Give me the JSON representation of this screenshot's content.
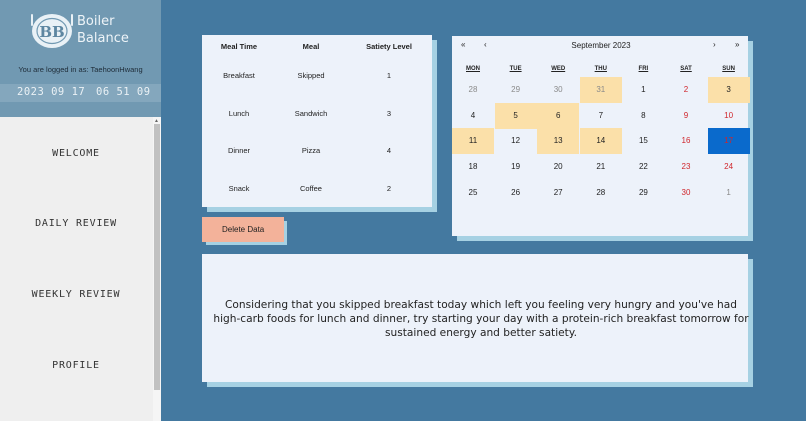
{
  "app": {
    "brand_line1": "Boiler",
    "brand_line2": "Balance",
    "logo_text": "BB"
  },
  "session": {
    "login_text": "You are logged in as: TaehoonHwang",
    "date": "2023 09 17",
    "time": "06 51 09"
  },
  "nav": [
    {
      "label": "WELCOME"
    },
    {
      "label": "DAILY REVIEW"
    },
    {
      "label": "WEEKLY REVIEW"
    },
    {
      "label": "PROFILE"
    }
  ],
  "meal_table": {
    "headers": [
      "Meal Time",
      "Meal",
      "Satiety Level"
    ],
    "rows": [
      [
        "Breakfast",
        "Skipped",
        "1"
      ],
      [
        "Lunch",
        "Sandwich",
        "3"
      ],
      [
        "Dinner",
        "Pizza",
        "4"
      ],
      [
        "Snack",
        "Coffee",
        "2"
      ]
    ]
  },
  "delete_button": "Delete Data",
  "calendar": {
    "title": "September 2023",
    "nav": {
      "prev_year": "«",
      "prev_month": "‹",
      "next_month": "›",
      "next_year": "»"
    },
    "weekdays": [
      "MON",
      "TUE",
      "WED",
      "THU",
      "FRI",
      "SAT",
      "SUN"
    ],
    "weeks": [
      [
        "28",
        "29",
        "30",
        "31",
        "1",
        "2",
        "3"
      ],
      [
        "4",
        "5",
        "6",
        "7",
        "8",
        "9",
        "10"
      ],
      [
        "11",
        "12",
        "13",
        "14",
        "15",
        "16",
        "17"
      ],
      [
        "18",
        "19",
        "20",
        "21",
        "22",
        "23",
        "24"
      ],
      [
        "25",
        "26",
        "27",
        "28",
        "29",
        "30",
        "1"
      ]
    ],
    "highlighted": [
      "31",
      "3",
      "5",
      "6",
      "11",
      "13",
      "14"
    ],
    "selected": "17",
    "colors": {
      "highlight": "#fbe0a9",
      "selected": "#0a6acc",
      "weekend": "#d0262c",
      "other_month": "#8a8a8a"
    }
  },
  "message": "Considering that you skipped breakfast today which left you feeling very hungry and you've had high-carb foods for lunch and dinner, try starting your day with a protein-rich breakfast tomorrow for sustained energy and better satiety.",
  "colors": {
    "background": "#4479a0",
    "card": "#edf2fa",
    "card_shadow": "#a6d1e3",
    "delete_button": "#f3b29a"
  }
}
